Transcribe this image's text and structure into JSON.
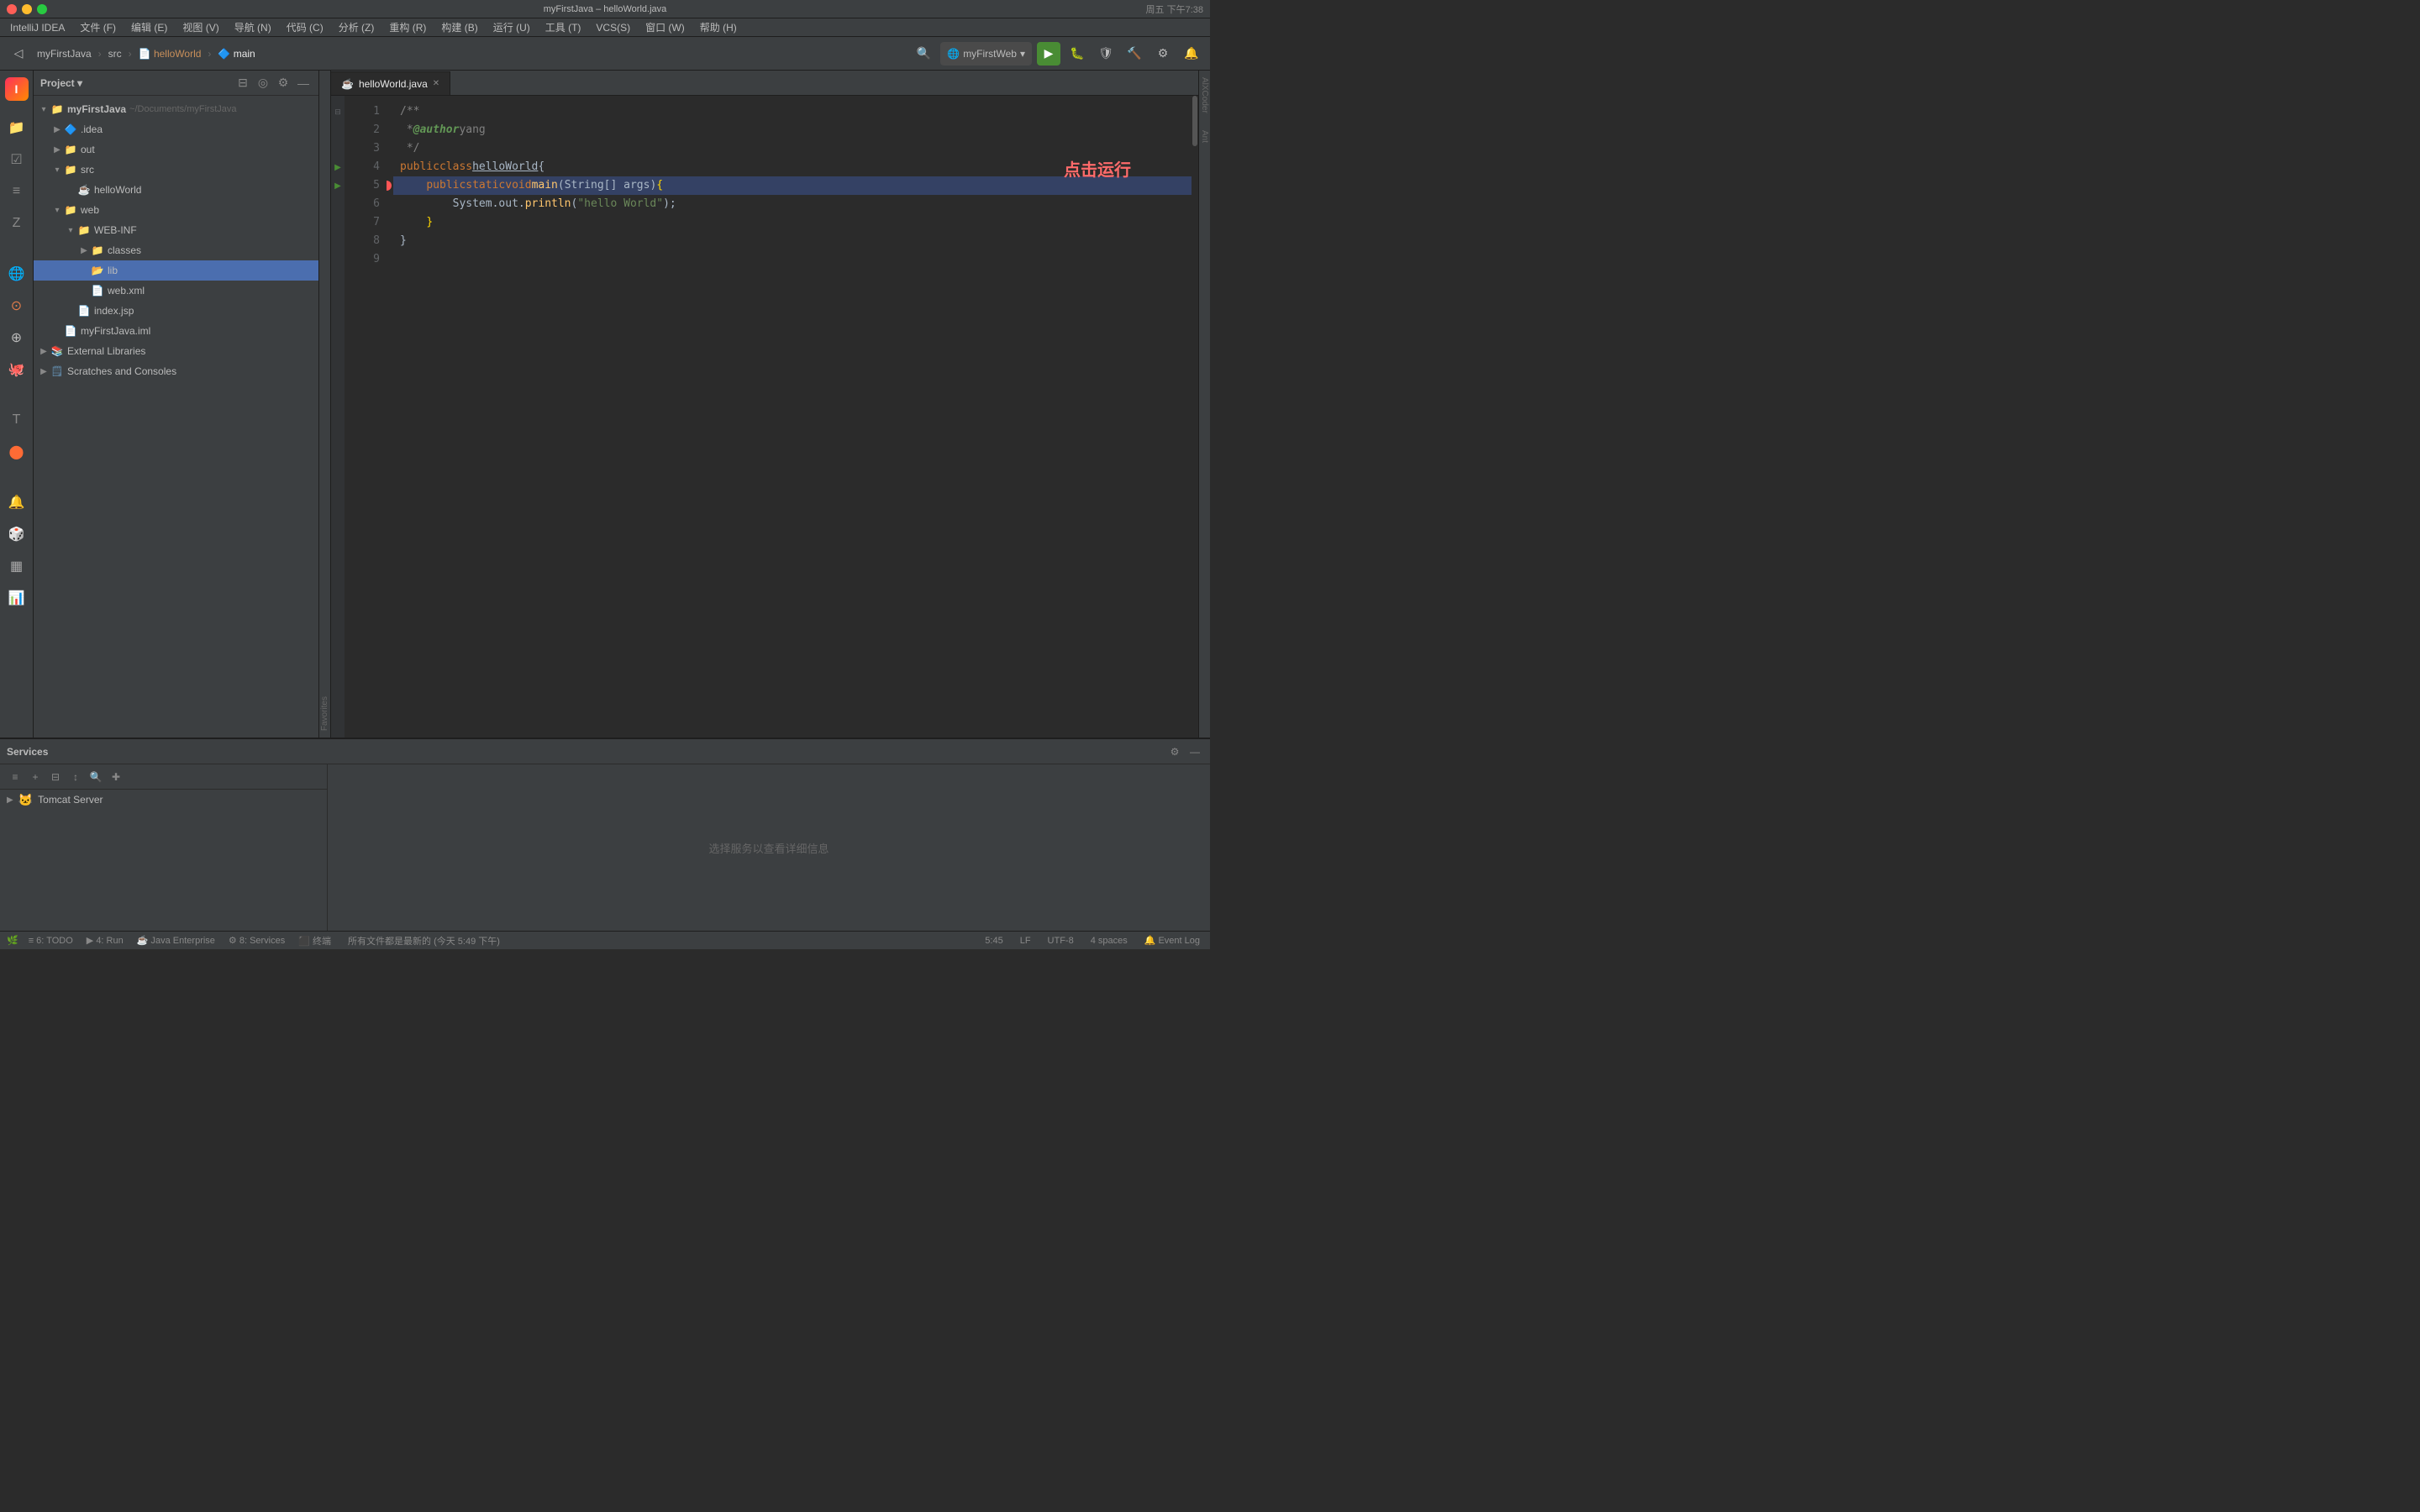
{
  "window": {
    "title": "myFirstJava – helloWorld.java",
    "traffic_lights": [
      "close",
      "minimize",
      "maximize"
    ]
  },
  "menu_bar": {
    "app_name": "IntelliJ IDEA",
    "items": [
      "文件 (F)",
      "编辑 (E)",
      "视图 (V)",
      "导航 (N)",
      "代码 (C)",
      "分析 (Z)",
      "重构 (R)",
      "构建 (B)",
      "运行 (U)",
      "工具 (T)",
      "VCS(S)",
      "窗口 (W)",
      "帮助 (H)"
    ],
    "datetime": "周五 下午7:38"
  },
  "toolbar": {
    "breadcrumb": [
      "myFirstJava",
      "src",
      "helloWorld",
      "main"
    ],
    "run_config": "myFirstWeb",
    "buttons": [
      "back",
      "forward",
      "settings",
      "search"
    ]
  },
  "file_tree": {
    "title": "Project",
    "root": "myFirstJava",
    "root_path": "~/Documents/myFirstJava",
    "items": [
      {
        "label": ".idea",
        "type": "folder",
        "depth": 1,
        "collapsed": true
      },
      {
        "label": "out",
        "type": "folder",
        "depth": 1,
        "collapsed": true
      },
      {
        "label": "src",
        "type": "folder",
        "depth": 1,
        "collapsed": false
      },
      {
        "label": "helloWorld",
        "type": "java",
        "depth": 2
      },
      {
        "label": "web",
        "type": "folder",
        "depth": 1,
        "collapsed": false
      },
      {
        "label": "WEB-INF",
        "type": "folder",
        "depth": 2,
        "collapsed": false
      },
      {
        "label": "classes",
        "type": "folder",
        "depth": 3,
        "collapsed": true
      },
      {
        "label": "lib",
        "type": "folder-lib",
        "depth": 3,
        "selected": true
      },
      {
        "label": "web.xml",
        "type": "xml",
        "depth": 3
      },
      {
        "label": "index.jsp",
        "type": "jsp",
        "depth": 2
      },
      {
        "label": "myFirstJava.iml",
        "type": "iml",
        "depth": 1
      },
      {
        "label": "External Libraries",
        "type": "external-libs",
        "depth": 0,
        "collapsed": true
      },
      {
        "label": "Scratches and Consoles",
        "type": "scratches",
        "depth": 0,
        "collapsed": true
      }
    ]
  },
  "editor": {
    "tab_name": "helloWorld.java",
    "annotation": "点击运行",
    "lines": [
      {
        "num": 1,
        "content": "/**",
        "type": "comment"
      },
      {
        "num": 2,
        "content": " * @author yang",
        "type": "comment-author"
      },
      {
        "num": 3,
        "content": " */",
        "type": "comment"
      },
      {
        "num": 4,
        "content": "public class helloWorld {",
        "type": "class-decl",
        "run_indicator": true,
        "foldable": false
      },
      {
        "num": 5,
        "content": "    public static void main(String[] args) {",
        "type": "method-decl",
        "run_indicator": true,
        "foldable": true,
        "breakpoint": true,
        "has_selection": true
      },
      {
        "num": 6,
        "content": "        System.out.println(\"hello World\");",
        "type": "code"
      },
      {
        "num": 7,
        "content": "    }",
        "type": "brace"
      },
      {
        "num": 8,
        "content": "}",
        "type": "brace"
      },
      {
        "num": 9,
        "content": "",
        "type": "empty"
      }
    ]
  },
  "bottom_panel": {
    "title": "Services",
    "service_items": [
      {
        "label": "Tomcat Server",
        "type": "tomcat"
      }
    ],
    "empty_message": "选择服务以查看详细信息"
  },
  "status_bar": {
    "left_items": [
      "6: TODO",
      "4: Run",
      "Java Enterprise",
      "8: Services",
      "终端"
    ],
    "file_info": "所有文件都是最新的 (今天 5:49 下午)",
    "right_items": [
      "5:45",
      "LF",
      "UTF-8",
      "4 spaces"
    ],
    "event_log": "Event Log"
  },
  "right_panel_labels": [
    "AlXCoder",
    "Ant"
  ],
  "left_panel_labels": [
    "Z-Structure",
    "Favorites",
    "Web"
  ],
  "colors": {
    "accent_green": "#498c34",
    "accent_blue": "#4b6eaf",
    "bg_dark": "#2b2b2b",
    "bg_medium": "#3c3f41",
    "text_primary": "#a9b7c6",
    "red_annotation": "#ff6b6b"
  }
}
